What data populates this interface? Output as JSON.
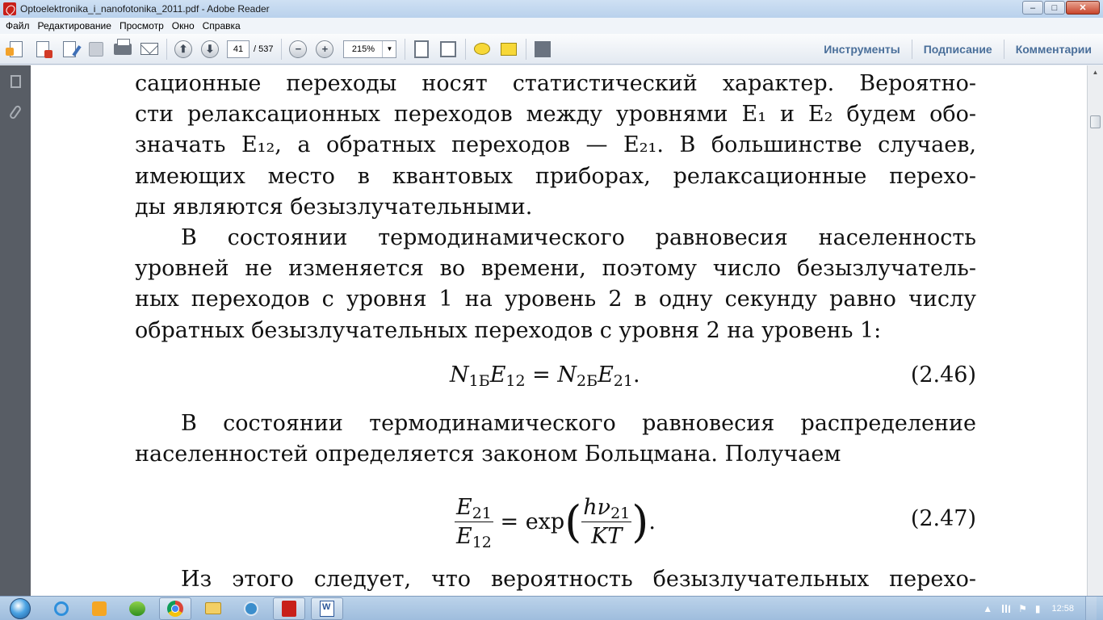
{
  "window": {
    "title": "Optoelektronika_i_nanofotonika_2011.pdf - Adobe Reader",
    "controls": {
      "minimize": "–",
      "maximize": "□",
      "close": "✕"
    }
  },
  "menu": {
    "items": [
      "Файл",
      "Редактирование",
      "Просмотр",
      "Окно",
      "Справка"
    ]
  },
  "toolbar": {
    "icons": [
      "create-pdf-icon",
      "combine-icon",
      "edit-icon",
      "save-icon",
      "print-icon",
      "email-icon",
      "previous-page-icon",
      "next-page-icon",
      "zoom-out-icon",
      "zoom-in-icon",
      "fit-page-icon",
      "fit-width-icon",
      "comment-icon",
      "highlight-icon",
      "expand-icon"
    ],
    "page_current": "41",
    "page_total": "/ 537",
    "zoom": "215%",
    "zoom_arrow": "▼",
    "zoom_out": "−",
    "zoom_in": "+",
    "prev": "⬆",
    "next": "⬇",
    "right_links": [
      "Инструменты",
      "Подписание",
      "Комментарии"
    ]
  },
  "document": {
    "para1_lines": [
      "сационные переходы носят статистический характер. Вероятно-",
      "сти релаксационных переходов между уровнями E₁ и E₂ будем обо-",
      "значать E₁₂, а обратных переходов — E₂₁. В большинстве случаев,",
      "имеющих место в квантовых приборах, релаксационные перехо-",
      "ды являются безызлучательными."
    ],
    "para2_lines": [
      "В состоянии термодинамического равновесия населенность",
      "уровней не изменяется во времени, поэтому число безызлучатель-",
      "ных переходов с уровня 1 на уровень 2 в одну секунду равно числу",
      "обратных безызлучательных переходов с уровня 2 на уровень 1:"
    ],
    "eq246": {
      "n1": "N",
      "n1_sub": "1Б",
      "e12": "E",
      "e12_sub": "12",
      "eq": " = ",
      "n2": "N",
      "n2_sub": "2Б",
      "e21": "E",
      "e21_sub": "21",
      "end": ".",
      "number": "(2.46)"
    },
    "para3_lines": [
      "В состоянии термодинамического равновесия распределение",
      "населенностей определяется законом Больцмана. Получаем"
    ],
    "eq247": {
      "num": "E",
      "num_sub": "21",
      "den": "E",
      "den_sub": "12",
      "eq": " = exp",
      "lparen": "(",
      "rparen": ")",
      "inner_num": "hν",
      "inner_num_sub": "21",
      "inner_den": "KT",
      "end": ".",
      "number": "(2.47)"
    },
    "para4_lines": [
      "Из этого следует, что вероятность безызлучательных перехо-"
    ]
  },
  "taskbar": {
    "apps": [
      "start-orb",
      "internet-explorer-icon",
      "media-player-icon",
      "media-center-icon",
      "chrome-icon",
      "explorer-folder-icon",
      "generic-app-icon",
      "acrobat-icon",
      "word-icon"
    ],
    "clock": "12:58",
    "tray_arrow": "▲"
  }
}
